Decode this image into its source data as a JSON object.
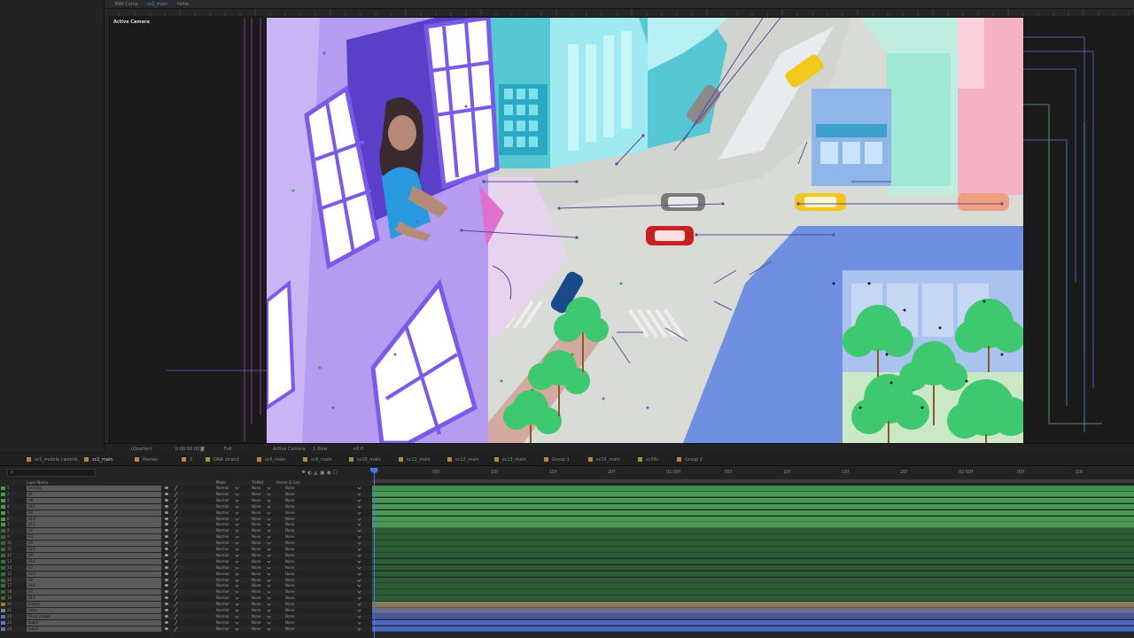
{
  "viewer": {
    "tabs": [
      {
        "label": "Edit Comp",
        "active": false
      },
      {
        "label": "sc2_main",
        "active": true
      },
      {
        "label": "fathe",
        "active": false
      }
    ],
    "active_camera_label": "Active Camera",
    "bar": {
      "zoom": "(Quarter)",
      "timecode": "0:00:00:00",
      "resolution": "Full",
      "camera": "Active Camera",
      "views": "1 View",
      "offset": "+0.0"
    }
  },
  "comp_tabs": [
    {
      "label": "sc1_mobile i wolnik",
      "color": "#b08a3a",
      "active": false
    },
    {
      "label": "sc2_main",
      "color": "#b08a3a",
      "active": true
    },
    {
      "label": "flames",
      "color": "#b08a3a",
      "active": false
    },
    {
      "label": "3",
      "color": "#b08a3a",
      "active": false
    },
    {
      "label": "DNA strand",
      "color": "#b08a3a",
      "active": false
    },
    {
      "label": "sc6_main",
      "color": "#b08a3a",
      "active": false
    },
    {
      "label": "sc8_main",
      "color": "#b08a3a",
      "active": false
    },
    {
      "label": "sc10_main",
      "color": "#b08a3a",
      "active": false
    },
    {
      "label": "sc11_main",
      "color": "#b08a3a",
      "active": false
    },
    {
      "label": "sc12_main",
      "color": "#b08a3a",
      "active": false
    },
    {
      "label": "sc13_main",
      "color": "#b08a3a",
      "active": false
    },
    {
      "label": "Group 1",
      "color": "#b08a3a",
      "active": false
    },
    {
      "label": "sc15_main",
      "color": "#b08a3a",
      "active": false
    },
    {
      "label": "sc34c",
      "color": "#b08a3a",
      "active": false
    },
    {
      "label": "Group 2",
      "color": "#b08a3a",
      "active": false
    }
  ],
  "timeline": {
    "search_placeholder": "ρ",
    "columns": {
      "layer_name": "Layer Name",
      "mode": "Mode",
      "trkmat": "TrkMat",
      "parent": "Parent & Link"
    },
    "ruler_ticks": [
      "0f",
      "05f",
      "10f",
      "15f",
      "20f",
      "01:00f",
      "05f",
      "10f",
      "15f",
      "20f",
      "02:00f",
      "05f",
      "10f"
    ],
    "layers": [
      {
        "num": "1",
        "name": "kamika",
        "label": "#4a9a4a",
        "mode": "Normal",
        "trkmat": "None",
        "parent": "None",
        "track": "#3f8f4a"
      },
      {
        "num": "2",
        "name": "d1",
        "label": "#4a9a4a",
        "mode": "Normal",
        "trkmat": "None",
        "parent": "None",
        "track": "#4a9a55"
      },
      {
        "num": "3",
        "name": "d8",
        "label": "#4a9a4a",
        "mode": "Normal",
        "trkmat": "None",
        "parent": "None",
        "track": "#4a9a55"
      },
      {
        "num": "4",
        "name": "d10",
        "label": "#4a9a4a",
        "mode": "Normal",
        "trkmat": "None",
        "parent": "None",
        "track": "#4a9a55"
      },
      {
        "num": "5",
        "name": "d9",
        "label": "#4a9a4a",
        "mode": "Normal",
        "trkmat": "None",
        "parent": "None",
        "track": "#4a9a55"
      },
      {
        "num": "6",
        "name": "d13",
        "label": "#4a9a4a",
        "mode": "Normal",
        "trkmat": "None",
        "parent": "None",
        "track": "#4a9a55"
      },
      {
        "num": "7",
        "name": "d11",
        "label": "#4a9a4a",
        "mode": "Normal",
        "trkmat": "None",
        "parent": "None",
        "track": "#4a9a55"
      },
      {
        "num": "8",
        "name": "d2",
        "label": "#3a6a3a",
        "mode": "Normal",
        "trkmat": "None",
        "parent": "None",
        "track": "#2e5c36"
      },
      {
        "num": "9",
        "name": "d3",
        "label": "#3a6a3a",
        "mode": "Normal",
        "trkmat": "None",
        "parent": "None",
        "track": "#2e5c36"
      },
      {
        "num": "10",
        "name": "d5",
        "label": "#3a6a3a",
        "mode": "Normal",
        "trkmat": "None",
        "parent": "None",
        "track": "#2e5c36"
      },
      {
        "num": "11",
        "name": "d12",
        "label": "#3a6a3a",
        "mode": "Normal",
        "trkmat": "None",
        "parent": "None",
        "track": "#2e5c36"
      },
      {
        "num": "12",
        "name": "d4",
        "label": "#3a6a3a",
        "mode": "Normal",
        "trkmat": "None",
        "parent": "None",
        "track": "#2e5c36"
      },
      {
        "num": "13",
        "name": "d14",
        "label": "#3a6a3a",
        "mode": "Normal",
        "trkmat": "None",
        "parent": "None",
        "track": "#2e5c36"
      },
      {
        "num": "14",
        "name": "d7",
        "label": "#3a6a3a",
        "mode": "Normal",
        "trkmat": "None",
        "parent": "None",
        "track": "#2e5c36"
      },
      {
        "num": "15",
        "name": "d15",
        "label": "#3a6a3a",
        "mode": "Normal",
        "trkmat": "None",
        "parent": "None",
        "track": "#2e5c36"
      },
      {
        "num": "16",
        "name": "d6",
        "label": "#3a6a3a",
        "mode": "Normal",
        "trkmat": "None",
        "parent": "None",
        "track": "#2e5c36"
      },
      {
        "num": "17",
        "name": "d16",
        "label": "#3a6a3a",
        "mode": "Normal",
        "trkmat": "None",
        "parent": "None",
        "track": "#2e5c36"
      },
      {
        "num": "18",
        "name": "d7",
        "label": "#3a6a3a",
        "mode": "Normal",
        "trkmat": "None",
        "parent": "None",
        "track": "#2e5c36"
      },
      {
        "num": "19",
        "name": "d17",
        "label": "#3a6a3a",
        "mode": "Normal",
        "trkmat": "None",
        "parent": "None",
        "track": "#2e5c36"
      },
      {
        "num": "20",
        "name": "[kaba]",
        "label": "#9a7a3a",
        "mode": "Normal",
        "trkmat": "None",
        "parent": "None",
        "track": "#8a7a5a"
      },
      {
        "num": "21",
        "name": "okno",
        "label": "#7a7a9a",
        "mode": "Normal",
        "trkmat": "None",
        "parent": "None",
        "track": "#6a6a8a"
      },
      {
        "num": "22",
        "name": "Skrzy prawe",
        "label": "#6a6aaa",
        "mode": "Normal",
        "trkmat": "None",
        "parent": "None",
        "track": "#4a5a9a"
      },
      {
        "num": "23",
        "name": "auto1",
        "label": "#5a7ac0",
        "mode": "Normal",
        "trkmat": "None",
        "parent": "None",
        "track": "#4a6ac0"
      },
      {
        "num": "24",
        "name": "auto2",
        "label": "#5a7ac0",
        "mode": "Normal",
        "trkmat": "None",
        "parent": "None",
        "track": "#4a6ac0"
      }
    ]
  },
  "colors": {
    "accent": "#3d7ae6",
    "panel": "#232323",
    "background": "#1d1d1d"
  }
}
